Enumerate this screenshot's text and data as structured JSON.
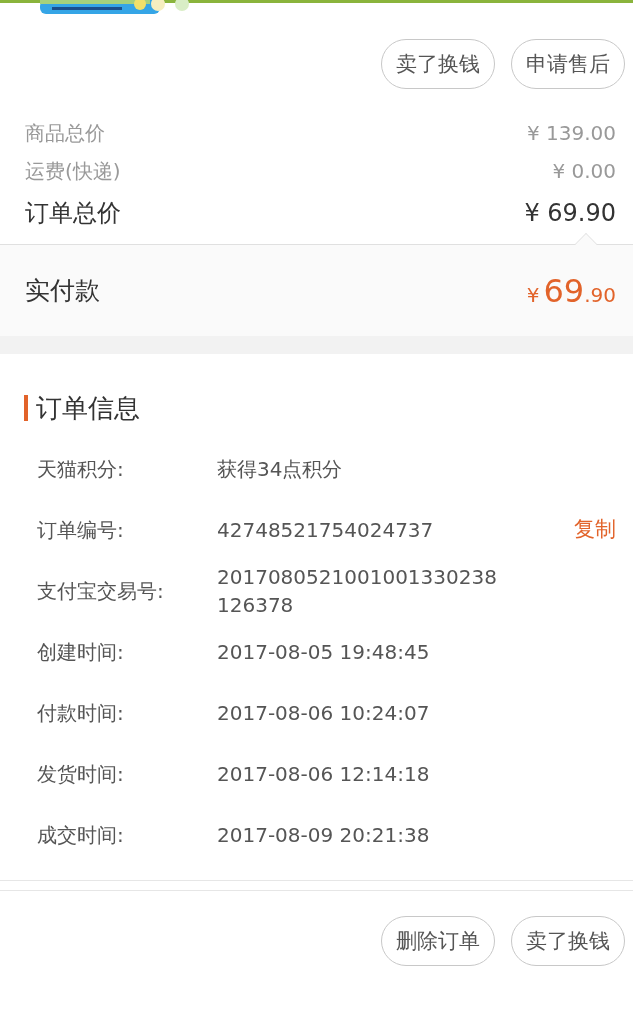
{
  "top_actions": [
    {
      "label": "卖了换钱"
    },
    {
      "label": "申请售后"
    }
  ],
  "price_rows": [
    {
      "kind": "minor",
      "label": "商品总价",
      "value": "¥ 139.00"
    },
    {
      "kind": "minor",
      "label": "运费(快递)",
      "value": "¥ 0.00"
    },
    {
      "kind": "total",
      "label": "订单总价",
      "value": "¥ 69.90"
    }
  ],
  "paid": {
    "label": "实付款",
    "currency": "¥",
    "integer": "69",
    "decimal": ".90"
  },
  "order_info": {
    "title": "订单信息",
    "rows": [
      {
        "label": "天猫积分:",
        "value": "获得34点积分"
      },
      {
        "label": "订单编号:",
        "value": "42748521754024737",
        "action": "复制"
      },
      {
        "label": "支付宝交易号:",
        "value": "2017080521001001330238126378"
      },
      {
        "label": "创建时间:",
        "value": "2017-08-05 19:48:45"
      },
      {
        "label": "付款时间:",
        "value": "2017-08-06 10:24:07"
      },
      {
        "label": "发货时间:",
        "value": "2017-08-06 12:14:18"
      },
      {
        "label": "成交时间:",
        "value": "2017-08-09 20:21:38"
      }
    ]
  },
  "bottom_actions": [
    {
      "label": "删除订单"
    },
    {
      "label": "卖了换钱"
    }
  ]
}
